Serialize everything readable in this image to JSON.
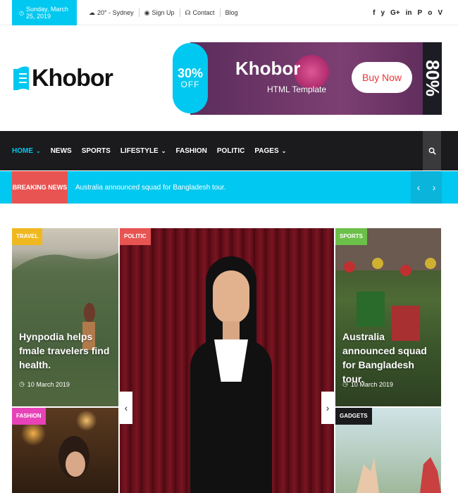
{
  "topbar": {
    "date": "Sunday, March 25, 2019",
    "weather": "20° - Sydney",
    "signup": "Sign Up",
    "contact": "Contact",
    "blog": "Blog",
    "socials": [
      "f",
      "y",
      "G+",
      "in",
      "P",
      "o",
      "V"
    ]
  },
  "header": {
    "logo_text": "Khobor",
    "ad": {
      "percent": "30%",
      "off": "OFF",
      "title": "Khobor",
      "subtitle": "HTML Template",
      "button": "Buy Now",
      "side_text": "80%"
    }
  },
  "nav": {
    "items": [
      {
        "label": "HOME",
        "dropdown": true,
        "active": true
      },
      {
        "label": "NEWS",
        "dropdown": false
      },
      {
        "label": "SPORTS",
        "dropdown": false
      },
      {
        "label": "LIFESTYLE",
        "dropdown": true
      },
      {
        "label": "FASHION",
        "dropdown": false
      },
      {
        "label": "POLITIC",
        "dropdown": false
      },
      {
        "label": "PAGES",
        "dropdown": true
      }
    ],
    "search_icon": "search-icon"
  },
  "breaking": {
    "label": "BREAKING NEWS",
    "text": "Australia announced squad for Bangladesh tour.",
    "prev": "‹",
    "next": "›"
  },
  "cards": {
    "travel": {
      "tag": "TRAVEL",
      "title": "Hynpodia helps fmale travelers find health.",
      "date": "10 March 2019"
    },
    "politic": {
      "tag": "POLITIC"
    },
    "sports": {
      "tag": "SPORTS",
      "title": "Australia announced squad for Bangladesh tour.",
      "date": "10 March 2019"
    },
    "fashion": {
      "tag": "FASHION"
    },
    "gadgets": {
      "tag": "GADGETS"
    }
  },
  "slider": {
    "prev": "‹",
    "next": "›"
  },
  "colors": {
    "accent": "#00c8f0",
    "breaking_red": "#e85452",
    "nav_bg": "#1b1b1d",
    "travel": "#f0b820",
    "sports": "#6cc04a",
    "fashion": "#e842b8"
  }
}
